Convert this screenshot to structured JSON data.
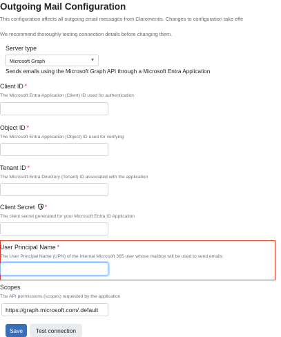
{
  "header": {
    "title": "Outgoing Mail Configuration",
    "intro": "This configuration affects all outgoing email messages from Claromentis. Changes to configuration take effe",
    "recommend": "We recommend thoroughly testing connection details before changing them."
  },
  "server_type": {
    "label": "Server type",
    "selected": "Microsoft Graph",
    "description": "Sends emails using the Microsoft Graph API through a Microsoft Entra Application"
  },
  "fields": {
    "client_id": {
      "label": "Client ID",
      "required": "*",
      "help": "The Microsoft Entra Application (Client) ID used for authentication",
      "value": ""
    },
    "object_id": {
      "label": "Object ID",
      "required": "*",
      "help": "The Microsoft Entra Application (Object) ID used for verifying",
      "value": ""
    },
    "tenant_id": {
      "label": "Tenant ID",
      "required": "*",
      "help": "The Microsoft Entra Directory (Tenant) ID associated with the application",
      "value": ""
    },
    "client_secret": {
      "label": "Client Secret",
      "required": "*",
      "icon": "shield-icon",
      "help": "The client secret generated for your Microsoft Entra ID Application",
      "value": ""
    },
    "upn": {
      "label": "User Principal Name",
      "required": "*",
      "help": "The User Principal Name (UPN) of the internal Microsoft 365 user whose mailbox will be used to send emails",
      "value": ""
    },
    "scopes": {
      "label": "Scopes",
      "help": "The API permissions (scopes) requested by the application",
      "value": "https://graph.microsoft.com/.default"
    }
  },
  "buttons": {
    "save": "Save",
    "test": "Test connection"
  },
  "colors": {
    "required": "#d63031",
    "highlight": "#e03b24",
    "primary": "#3a6fb7"
  }
}
